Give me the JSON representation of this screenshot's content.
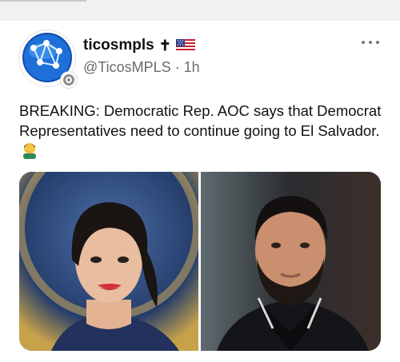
{
  "post": {
    "display_name": "ticosmpls",
    "name_suffix_glyph": "✝",
    "flag": "us-flag-icon",
    "handle": "@TicosMPLS",
    "separator": "·",
    "time_ago": "1h",
    "text": "BREAKING: Democratic Rep. AOC says that Democrat Representatives need to continue going to El Salvador.",
    "text_emoji": "man-facepalming-emoji",
    "more_icon": "more-options-icon"
  },
  "media": {
    "images": [
      {
        "name": "photo-woman-portrait"
      },
      {
        "name": "photo-man-portrait"
      }
    ]
  },
  "colors": {
    "text": "#111111",
    "muted": "#6b6b6b",
    "avatar_blue": "#1e6fd9"
  }
}
